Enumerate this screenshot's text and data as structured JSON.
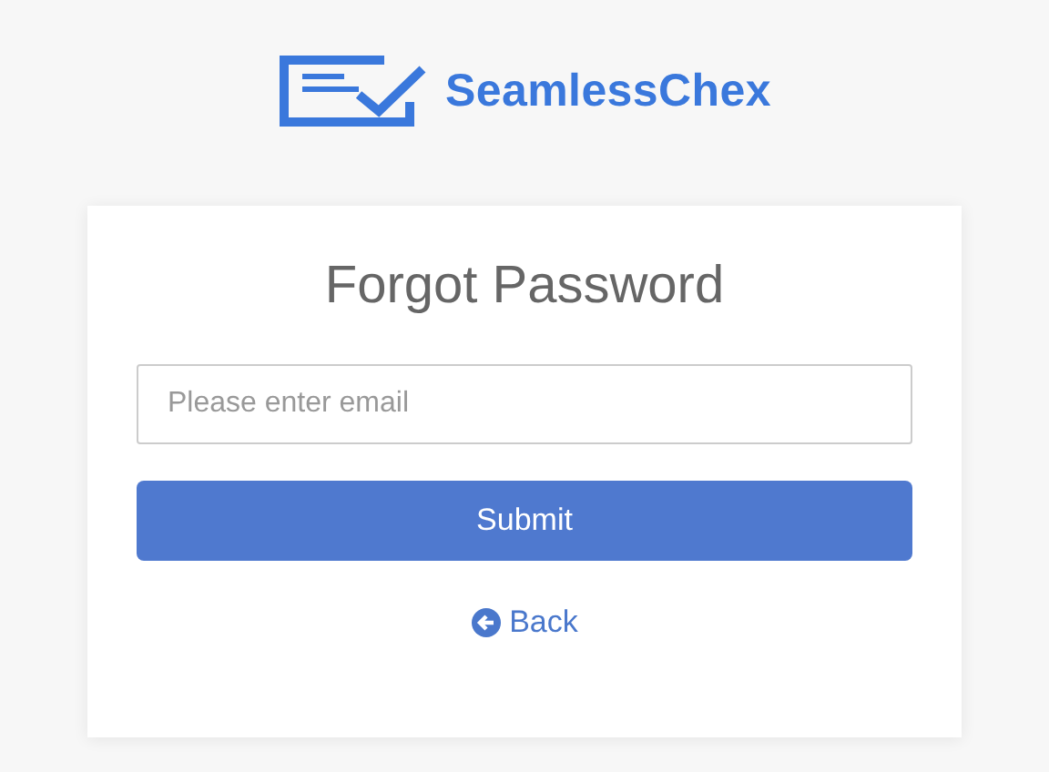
{
  "logo": {
    "text": "SeamlessChex"
  },
  "form": {
    "title": "Forgot Password",
    "email": {
      "placeholder": "Please enter email"
    },
    "submit": "Submit",
    "back": "Back"
  }
}
